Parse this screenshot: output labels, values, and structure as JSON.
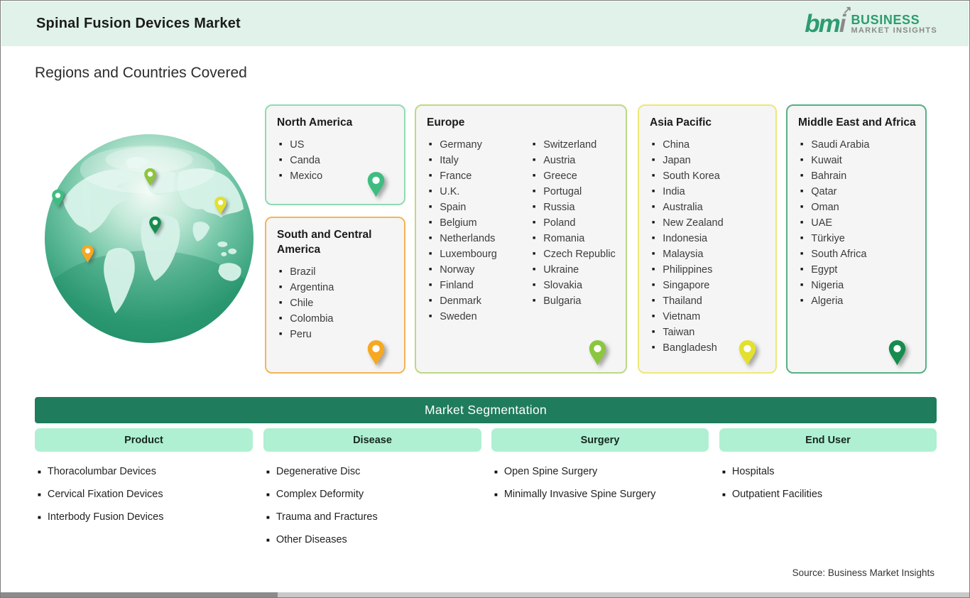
{
  "header": {
    "title": "Spinal Fusion Devices Market",
    "logo": {
      "mark_green": "bm",
      "mark_gray": "i",
      "arrow": "↗",
      "line1": "BUSINESS",
      "line2": "MARKET INSIGHTS"
    }
  },
  "section_title": "Regions and Countries Covered",
  "regions": [
    {
      "id": "north-america",
      "name": "North America",
      "columns": [
        [
          "US",
          "Canda",
          "Mexico"
        ]
      ],
      "border_color": "#8edcb2",
      "pin_color": "#3fbd80"
    },
    {
      "id": "south-central-america",
      "name": "South and Central America",
      "columns": [
        [
          "Brazil",
          "Argentina",
          "Chile",
          "Colombia",
          "Peru"
        ]
      ],
      "border_color": "#f4b459",
      "pin_color": "#f6a820"
    },
    {
      "id": "europe",
      "name": "Europe",
      "columns": [
        [
          "Germany",
          "Italy",
          "France",
          "U.K.",
          "Spain",
          "Belgium",
          "Netherlands",
          "Luxembourg",
          "Norway",
          "Finland",
          "Denmark",
          "Sweden"
        ],
        [
          "Switzerland",
          "Austria",
          "Greece",
          "Portugal",
          "Russia",
          "Poland",
          "Romania",
          "Czech Republic",
          "Ukraine",
          "Slovakia",
          "Bulgaria"
        ]
      ],
      "border_color": "#bcd983",
      "pin_color": "#8cc63e"
    },
    {
      "id": "asia-pacific",
      "name": "Asia Pacific",
      "columns": [
        [
          "China",
          "Japan",
          "South Korea",
          "India",
          "Australia",
          "New Zealand",
          "Indonesia",
          "Malaysia",
          "Philippines",
          "Singapore",
          "Thailand",
          "Vietnam",
          "Taiwan",
          "Bangladesh"
        ]
      ],
      "border_color": "#eee878",
      "pin_color": "#e3e02e"
    },
    {
      "id": "middle-east-africa",
      "name": "Middle East and Africa",
      "columns": [
        [
          "Saudi Arabia",
          "Kuwait",
          "Bahrain",
          "Qatar",
          "Oman",
          "UAE",
          "Türkiye",
          "South Africa",
          "Egypt",
          "Nigeria",
          "Algeria"
        ]
      ],
      "border_color": "#57b084",
      "pin_color": "#168c4e"
    }
  ],
  "segmentation": {
    "title": "Market Segmentation",
    "columns": [
      {
        "label": "Product",
        "items": [
          "Thoracolumbar Devices",
          "Cervical Fixation Devices",
          "Interbody Fusion Devices"
        ]
      },
      {
        "label": "Disease",
        "items": [
          "Degenerative Disc",
          "Complex Deformity",
          "Trauma and Fractures",
          "Other Diseases"
        ]
      },
      {
        "label": "Surgery",
        "items": [
          "Open Spine Surgery",
          "Minimally Invasive Spine Surgery"
        ]
      },
      {
        "label": "End User",
        "items": [
          "Hospitals",
          "Outpatient Facilities"
        ]
      }
    ]
  },
  "source": "Source: Business Market Insights",
  "colors": {
    "header_bg": "#e0f2e9",
    "banner_bg": "#1f7c5c",
    "pill_bg": "#b0f0d2",
    "logo_green": "#2e9b71",
    "logo_gray": "#8a8a8a"
  }
}
